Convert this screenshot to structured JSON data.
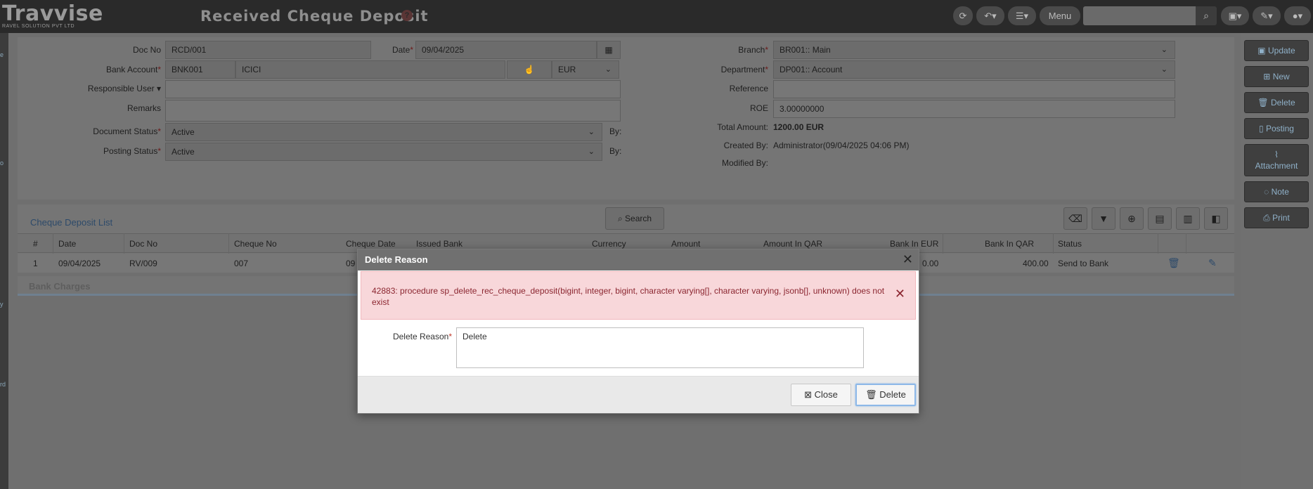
{
  "app": {
    "logo_text": "Travvise",
    "logo_tagline": "RAVEL SOLUTION PVT LTD",
    "page_title": "Received Cheque Deposit",
    "help": "?",
    "menu_label": "Menu"
  },
  "form": {
    "doc_no": {
      "label": "Doc No",
      "value": "RCD/001"
    },
    "date": {
      "label": "Date",
      "value": "09/04/2025"
    },
    "bank_account": {
      "label": "Bank Account",
      "code": "BNK001",
      "name": "ICICI",
      "currency": "EUR"
    },
    "responsible_user": {
      "label": "Responsible User",
      "value": ""
    },
    "remarks": {
      "label": "Remarks",
      "value": ""
    },
    "document_status": {
      "label": "Document Status",
      "value": "Active",
      "by_label": "By:"
    },
    "posting_status": {
      "label": "Posting Status",
      "value": "Active",
      "by_label": "By:"
    },
    "branch": {
      "label": "Branch",
      "value": "BR001:: Main"
    },
    "department": {
      "label": "Department",
      "value": "DP001:: Account"
    },
    "reference": {
      "label": "Reference",
      "value": ""
    },
    "roe": {
      "label": "ROE",
      "value": "3.00000000"
    },
    "total_amount": {
      "label": "Total Amount:",
      "value": "1200.00 EUR"
    },
    "created_by": {
      "label": "Created By:",
      "value": "Administrator(09/04/2025 04:06 PM)"
    },
    "modified_by": {
      "label": "Modified By:",
      "value": ""
    }
  },
  "list": {
    "title": "Cheque Deposit List",
    "search_label": "Search",
    "columns": [
      "#",
      "Date",
      "Doc No",
      "Cheque No",
      "Cheque Date",
      "Issued Bank",
      "Currency",
      "Amount",
      "Amount In QAR",
      "Bank In EUR",
      "Bank In QAR",
      "Status"
    ],
    "rows": [
      {
        "num": "1",
        "date": "09/04/2025",
        "doc_no": "RV/009",
        "cheque_no": "007",
        "cheque_date": "09",
        "bank_in_eur": "0.00",
        "bank_in_qar": "400.00",
        "status": "Send to Bank"
      }
    ]
  },
  "bank_charges": {
    "title": "Bank Charges"
  },
  "actions": {
    "update": "Update",
    "new": "New",
    "delete": "Delete",
    "posting": "Posting",
    "attachment": "Attachment",
    "note": "Note",
    "print": "Print"
  },
  "modal": {
    "title": "Delete Reason",
    "error": "42883: procedure sp_delete_rec_cheque_deposit(bigint, integer, bigint, character varying[], character varying, jsonb[], unknown) does not exist",
    "reason_label": "Delete Reason",
    "reason_value": "Delete",
    "close_label": "Close",
    "delete_label": "Delete"
  },
  "left_strip": {
    "letters": [
      "e",
      "o",
      "y",
      "rd"
    ]
  },
  "colors": {
    "alert_bg": "#f8d7da",
    "alert_text": "#8b2630",
    "topbar": "#2a2a2a",
    "action_text": "#8fb0c8"
  }
}
